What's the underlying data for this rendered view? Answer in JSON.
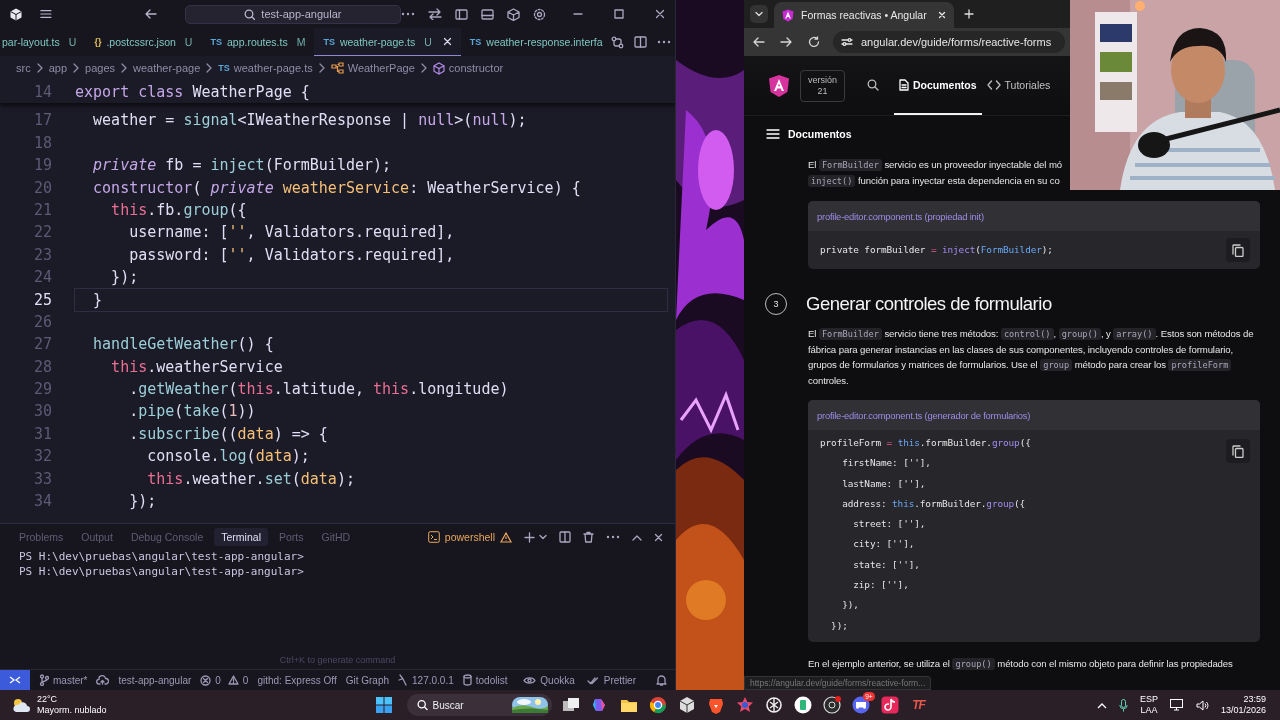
{
  "editor": {
    "title_search": "test-app-angular",
    "tabs": [
      {
        "label": "par-layout.ts",
        "status": "U",
        "selected": false
      },
      {
        "icon": "{}",
        "label": ".postcssrc.json",
        "status": "U",
        "selected": false
      },
      {
        "icon": "TS",
        "label": "app.routes.ts",
        "status": "M",
        "selected": false
      },
      {
        "icon": "TS",
        "label": "weather-page.ts",
        "status": "U",
        "selected": true
      },
      {
        "icon": "TS",
        "label": "weather-response.interfa",
        "selected": false
      }
    ],
    "breadcrumb": [
      {
        "label": "src",
        "kind": "folder"
      },
      {
        "label": "app",
        "kind": "folder"
      },
      {
        "label": "pages",
        "kind": "folder"
      },
      {
        "label": "weather-page",
        "kind": "folder"
      },
      {
        "label": "weather-page.ts",
        "kind": "file",
        "icon": "TS"
      },
      {
        "label": "WeatherPage",
        "kind": "class"
      },
      {
        "label": "constructor",
        "kind": "method"
      }
    ],
    "sticky": {
      "number": "14",
      "tokens": [
        {
          "t": "export ",
          "kind": "kw"
        },
        {
          "t": "class ",
          "kind": "kw"
        },
        {
          "t": "WeatherPage",
          "kind": "type"
        },
        {
          "t": " {"
        }
      ]
    },
    "lines": [
      {
        "number": "17",
        "current": false,
        "tokens": [
          {
            "t": "  weather",
            "kind": "prop"
          },
          {
            "t": " = "
          },
          {
            "t": "signal",
            "kind": "fn"
          },
          {
            "t": "<"
          },
          {
            "t": "IWeatherResponse",
            "kind": "type"
          },
          {
            "t": " | "
          },
          {
            "t": "null",
            "kind": "kw"
          },
          {
            "t": ">("
          },
          {
            "t": "null",
            "kind": "kw"
          },
          {
            "t": ");"
          }
        ]
      },
      {
        "number": "18",
        "current": false
      },
      {
        "number": "19",
        "current": false,
        "tokens": [
          {
            "t": "  private",
            "kind": "kwi"
          },
          {
            "t": " fb = "
          },
          {
            "t": "inject",
            "kind": "fn"
          },
          {
            "t": "("
          },
          {
            "t": "FormBuilder",
            "kind": "type"
          },
          {
            "t": ");"
          }
        ]
      },
      {
        "number": "20",
        "current": false,
        "tokens": [
          {
            "t": "  constructor",
            "kind": "kw"
          },
          {
            "t": "( "
          },
          {
            "t": "private ",
            "kind": "kwi"
          },
          {
            "t": "weatherService",
            "kind": "param"
          },
          {
            "t": ": "
          },
          {
            "t": "WeatherService",
            "kind": "type"
          },
          {
            "t": ") {"
          }
        ]
      },
      {
        "number": "21",
        "current": false,
        "tokens": [
          {
            "t": "    this",
            "kind": "this"
          },
          {
            "t": ".fb."
          },
          {
            "t": "group",
            "kind": "fn"
          },
          {
            "t": "({"
          }
        ]
      },
      {
        "number": "22",
        "current": false,
        "tokens": [
          {
            "t": "      username",
            "kind": "prop"
          },
          {
            "t": ": ["
          },
          {
            "t": "''",
            "kind": "str"
          },
          {
            "t": ", "
          },
          {
            "t": "Validators",
            "kind": "type"
          },
          {
            "t": ".required],"
          }
        ]
      },
      {
        "number": "23",
        "current": false,
        "tokens": [
          {
            "t": "      password",
            "kind": "prop"
          },
          {
            "t": ": ["
          },
          {
            "t": "''",
            "kind": "str"
          },
          {
            "t": ", "
          },
          {
            "t": "Validators",
            "kind": "type"
          },
          {
            "t": ".required],"
          }
        ]
      },
      {
        "number": "24",
        "current": false,
        "tokens": [
          {
            "t": "    });"
          }
        ]
      },
      {
        "number": "25",
        "current": true,
        "tokens": [
          {
            "t": "  }"
          }
        ]
      },
      {
        "number": "26",
        "current": false
      },
      {
        "number": "27",
        "current": false,
        "tokens": [
          {
            "t": "  handleGetWeather",
            "kind": "fn"
          },
          {
            "t": "() {"
          }
        ]
      },
      {
        "number": "28",
        "current": false,
        "tokens": [
          {
            "t": "    this",
            "kind": "this"
          },
          {
            "t": "."
          },
          {
            "t": "weatherService",
            "kind": "prop"
          }
        ]
      },
      {
        "number": "29",
        "current": false,
        "tokens": [
          {
            "t": "      ."
          },
          {
            "t": "getWeather",
            "kind": "fn"
          },
          {
            "t": "("
          },
          {
            "t": "this",
            "kind": "this"
          },
          {
            "t": ".latitude, "
          },
          {
            "t": "this",
            "kind": "this"
          },
          {
            "t": ".longitude)"
          }
        ]
      },
      {
        "number": "30",
        "current": false,
        "tokens": [
          {
            "t": "      ."
          },
          {
            "t": "pipe",
            "kind": "fn"
          },
          {
            "t": "("
          },
          {
            "t": "take",
            "kind": "fn"
          },
          {
            "t": "("
          },
          {
            "t": "1",
            "kind": "num"
          },
          {
            "t": "))"
          }
        ]
      },
      {
        "number": "31",
        "current": false,
        "tokens": [
          {
            "t": "      ."
          },
          {
            "t": "subscribe",
            "kind": "fn"
          },
          {
            "t": "(("
          },
          {
            "t": "data",
            "kind": "param"
          },
          {
            "t": ") => {"
          }
        ]
      },
      {
        "number": "32",
        "current": false,
        "tokens": [
          {
            "t": "        console",
            "kind": "type"
          },
          {
            "t": "."
          },
          {
            "t": "log",
            "kind": "fn"
          },
          {
            "t": "("
          },
          {
            "t": "data",
            "kind": "param"
          },
          {
            "t": ");"
          }
        ]
      },
      {
        "number": "33",
        "current": false,
        "tokens": [
          {
            "t": "        this",
            "kind": "this"
          },
          {
            "t": ".weather."
          },
          {
            "t": "set",
            "kind": "fn"
          },
          {
            "t": "("
          },
          {
            "t": "data",
            "kind": "param"
          },
          {
            "t": ");"
          }
        ]
      },
      {
        "number": "34",
        "current": false,
        "tokens": [
          {
            "t": "      });"
          }
        ]
      }
    ],
    "panel": {
      "tabs": [
        {
          "label": "Problems",
          "selected": false
        },
        {
          "label": "Output",
          "selected": false
        },
        {
          "label": "Debug Console",
          "selected": false
        },
        {
          "label": "Terminal",
          "selected": true
        },
        {
          "label": "Ports",
          "selected": false
        },
        {
          "label": "GitHD",
          "selected": false
        }
      ],
      "shell": "powershell",
      "terminal": [
        "PS H:\\dev\\pruebas\\angular\\test-app-angular>",
        "PS H:\\dev\\pruebas\\angular\\test-app-angular>"
      ],
      "hint": "Ctrl+K to generate command"
    },
    "status": {
      "branch": "master*",
      "project": "test-app-angular",
      "errors": "0",
      "warnings": "0",
      "items": [
        "githd: Express Off",
        "Git Graph"
      ],
      "host": "127.0.0.1",
      "database": "todolist",
      "right": [
        "Quokka",
        "Prettier"
      ]
    }
  },
  "browser": {
    "tab": {
      "title": "Formas reactivas • Angular",
      "selected": true
    },
    "url": "angular.dev/guide/forms/reactive-forms",
    "site": {
      "version_label": "versión",
      "version": "21",
      "nav": [
        {
          "label": "Documentos",
          "selected": true
        },
        {
          "label": "Tutoriales",
          "selected": false
        }
      ],
      "section": "Documentos"
    },
    "content": [
      {
        "kind": "paragraph",
        "lines": [
          [
            {
              "t": "El ",
              "kind": "text"
            },
            {
              "t": "FormBuilder",
              "kind": "code"
            },
            {
              "t": " servicio es un proveedor inyectable del mó",
              "kind": "text"
            }
          ],
          [
            {
              "t": "inject()",
              "kind": "code"
            },
            {
              "t": " función para inyectar esta dependencia en su co",
              "kind": "text"
            }
          ]
        ]
      },
      {
        "kind": "code",
        "title": "profile-editor.component.ts (propiedad init)",
        "lines": [
          [
            {
              "t": "private formBuilder "
            },
            {
              "t": "= ",
              "kind": "op"
            },
            {
              "t": "inject",
              "kind": "fn"
            },
            {
              "t": "("
            },
            {
              "t": "FormBuilder",
              "kind": "this"
            },
            {
              "t": ");"
            }
          ]
        ]
      },
      {
        "kind": "step",
        "number": "3",
        "title": "Generar controles de formulario"
      },
      {
        "kind": "paragraph",
        "lines": [
          [
            {
              "t": "El ",
              "kind": "text"
            },
            {
              "t": "FormBuilder",
              "kind": "code"
            },
            {
              "t": " servicio tiene tres métodos: ",
              "kind": "text"
            },
            {
              "t": "control()",
              "kind": "code"
            },
            {
              "t": ", ",
              "kind": "text"
            },
            {
              "t": "group()",
              "kind": "code"
            },
            {
              "t": ", y ",
              "kind": "text"
            },
            {
              "t": "array()",
              "kind": "code"
            },
            {
              "t": ". Estos son métodos de fábrica para generar instancias en las clases de sus componentes, incluyendo controles de formulario, grupos de formularios y matrices de formularios. Use el ",
              "kind": "text"
            },
            {
              "t": "group",
              "kind": "code"
            },
            {
              "t": " método para crear los ",
              "kind": "text"
            },
            {
              "t": "profileForm",
              "kind": "code"
            },
            {
              "t": " controles.",
              "kind": "text"
            }
          ]
        ]
      },
      {
        "kind": "code",
        "title": "profile-editor.component.ts (generador de formularios)",
        "lines": [
          [
            {
              "t": "profileForm "
            },
            {
              "t": "= ",
              "kind": "op"
            },
            {
              "t": "this",
              "kind": "this"
            },
            {
              "t": ".formBuilder."
            },
            {
              "t": "group",
              "kind": "fn"
            },
            {
              "t": "({"
            }
          ],
          [
            {
              "t": "    firstName: [''],"
            }
          ],
          [
            {
              "t": "    lastName: [''],"
            }
          ],
          [
            {
              "t": "    address: "
            },
            {
              "t": "this",
              "kind": "this"
            },
            {
              "t": ".formBuilder."
            },
            {
              "t": "group",
              "kind": "fn"
            },
            {
              "t": "({"
            }
          ],
          [
            {
              "t": "      street: [''],"
            }
          ],
          [
            {
              "t": "      city: [''],"
            }
          ],
          [
            {
              "t": "      state: [''],"
            }
          ],
          [
            {
              "t": "      zip: [''],"
            }
          ],
          [
            {
              "t": "    }),"
            }
          ],
          [
            {
              "t": "  });"
            }
          ]
        ]
      },
      {
        "kind": "paragraph",
        "lines": [
          [
            {
              "t": "En el ejemplo anterior, se utiliza el ",
              "kind": "text"
            },
            {
              "t": "group()",
              "kind": "code"
            },
            {
              "t": " método con el mismo objeto para definir las propiedades",
              "kind": "text"
            }
          ]
        ]
      }
    ],
    "status_url": "https://angular.dev/guide/forms/reactive-form..."
  },
  "taskbar": {
    "temperature": "22°C",
    "weather": "Mayorm. nublado",
    "search": {
      "placeholder": "Buscar"
    },
    "badge": "9+",
    "tf_logo": "TF",
    "language": "ESP",
    "layout": "LAA",
    "time": "23:59",
    "date": "13/01/2026"
  }
}
